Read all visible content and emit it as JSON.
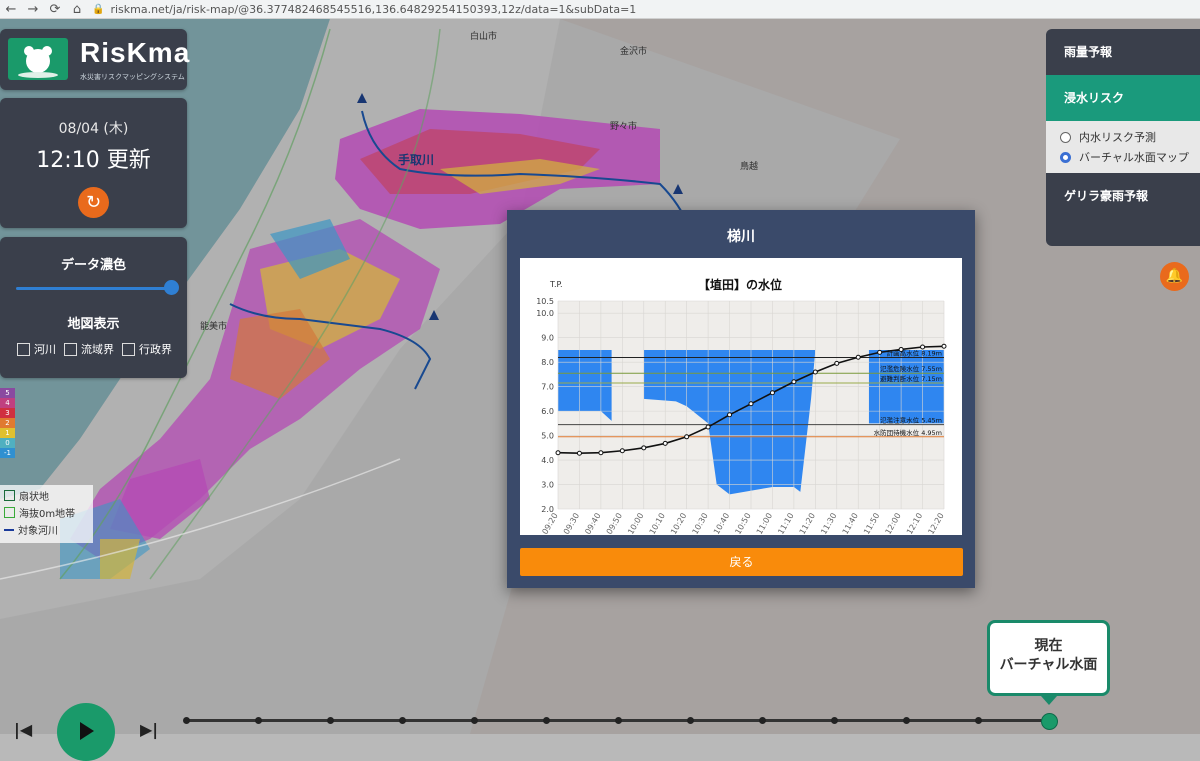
{
  "browser": {
    "url": "riskma.net/ja/risk-map/@36.377482468545516,136.64829254150393,12z/data=1&subData=1"
  },
  "header": {
    "logo_text": "RisKma",
    "logo_subtitle": "水災害リスクマッピングシステム"
  },
  "status": {
    "date": "08/04 (木)",
    "updated": "12:10 更新"
  },
  "options": {
    "data_color_label": "データ濃色",
    "map_display_label": "地図表示",
    "checkboxes": [
      "河川",
      "流域界",
      "行政界"
    ]
  },
  "scale_labels": [
    "5",
    "4",
    "3",
    "2",
    "1",
    "0",
    "-1"
  ],
  "layer_legend": [
    "扇状地",
    "海抜0m地帯",
    "対象河川"
  ],
  "right_menu": {
    "rain_forecast": "雨量予報",
    "flood_risk": "浸水リスク",
    "radio_options": [
      "内水リスク予測",
      "バーチャル水面マップ"
    ],
    "guerrilla": "ゲリラ豪雨予報"
  },
  "map_labels": [
    "白山市",
    "手取川",
    "能美市",
    "野々市",
    "金沢市",
    "鳥越"
  ],
  "modal": {
    "title": "梯川",
    "back_label": "戻る"
  },
  "callout": {
    "line1": "現在",
    "line2": "バーチャル水面"
  },
  "colors": {
    "panel": "#3a3f4b",
    "accent_green": "#1a9a6a",
    "orange": "#f98b0b",
    "water_blue": "#2f86f0"
  },
  "chart_data": {
    "type": "line",
    "title": "【埴田】の水位",
    "ylabel": "T.P.",
    "ylim": [
      2.0,
      10.5
    ],
    "yticks": [
      "2.0",
      "3.0",
      "4.0",
      "5.0",
      "6.0",
      "7.0",
      "8.0",
      "9.0",
      "10.0",
      "10.5"
    ],
    "x": [
      "09:20",
      "09:30",
      "09:40",
      "09:50",
      "10:00",
      "10:10",
      "10:20",
      "10:30",
      "10:40",
      "10:50",
      "11:00",
      "11:10",
      "11:20",
      "11:30",
      "11:40",
      "11:50",
      "12:00",
      "12:10",
      "12:20"
    ],
    "series": [
      {
        "values": [
          4.3,
          4.28,
          4.3,
          4.38,
          4.5,
          4.68,
          4.95,
          5.35,
          5.85,
          6.3,
          6.75,
          7.2,
          7.6,
          7.95,
          8.2,
          8.4,
          8.52,
          8.62,
          8.65
        ]
      }
    ],
    "thresholds": [
      {
        "label": "計画高水位 8.19m",
        "value": 8.19,
        "color": "#222222"
      },
      {
        "label": "氾濫危険水位 7.55m",
        "value": 7.55,
        "color": "#7a9a3a"
      },
      {
        "label": "避難判断水位 7.15m",
        "value": 7.15,
        "color": "#9aaa4a"
      },
      {
        "label": "氾濫注意水位 5.45m",
        "value": 5.45,
        "color": "#444444"
      },
      {
        "label": "水防団待機水位 4.95m",
        "value": 4.95,
        "color": "#e07a30"
      }
    ]
  }
}
